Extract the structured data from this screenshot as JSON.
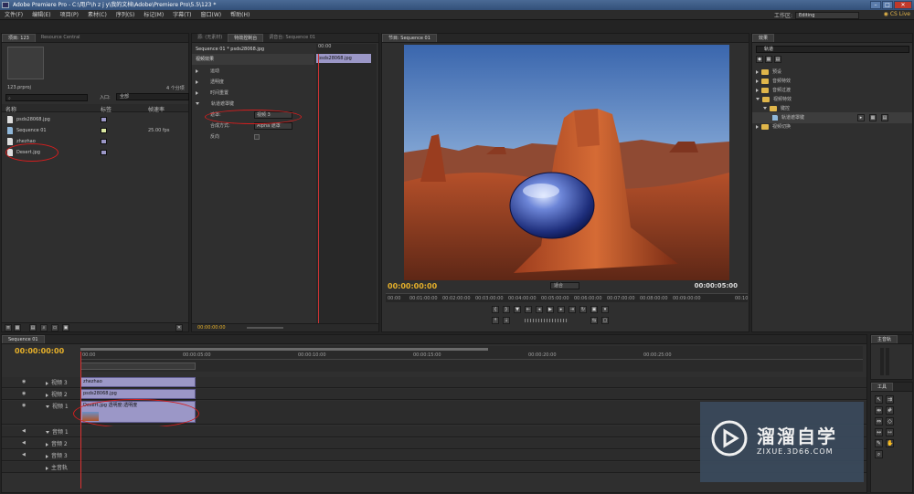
{
  "title_bar": {
    "text": "Adobe Premiere Pro - C:\\用户\\h z j y\\我的文档\\Adobe\\Premiere Pro\\5.5\\123 *"
  },
  "menu": [
    "文件(F)",
    "编辑(E)",
    "项目(P)",
    "素材(C)",
    "序列(S)",
    "标记(M)",
    "字幕(T)",
    "窗口(W)",
    "帮助(H)"
  ],
  "workspace": {
    "label": "工作区:",
    "value": "Editing",
    "cs_live": "CS Live"
  },
  "project_panel": {
    "tabs": [
      "项目: 123",
      "Resource Central"
    ],
    "project_file": "123.prproj",
    "item_count": "4 个分项",
    "search_placeholder": "",
    "in_label": "入口:",
    "in_value": "全部",
    "columns": [
      "名称",
      "标签",
      "帧速率"
    ],
    "items": [
      {
        "name": "psds28068.jpg",
        "label_color": "#9b97c7",
        "fps": ""
      },
      {
        "name": "Sequence 01",
        "label_color": "#d9e6a0",
        "fps": "25.00 fps"
      },
      {
        "name": "zhezhao",
        "label_color": "#9b97c7",
        "fps": ""
      },
      {
        "name": "Desert.jpg",
        "label_color": "#9b97c7",
        "fps": ""
      }
    ]
  },
  "effect_controls": {
    "tabs": [
      "源: (无素材)",
      "特效控制台",
      "调音台: Sequence 01"
    ],
    "header": "Sequence 01 * psds28068.jpg",
    "clip_name": "psds28068.jpg",
    "section": "视频效果",
    "rows": [
      "运动",
      "透明度",
      "时间重置",
      "轨道遮罩键"
    ],
    "mask_label": "遮罩:",
    "mask_value": "视频 3",
    "composite_label": "合成方式:",
    "composite_value": "Alpha 遮罩",
    "reverse_label": "反向",
    "mini_tc": "00:00",
    "footer_tc": "00:00:00:00"
  },
  "program_monitor": {
    "tab": "节目: Sequence 01",
    "current_tc": "00:00:00:00",
    "fit": "适合",
    "duration_tc": "00:00:05:00",
    "ruler": [
      "00:00",
      "00:01:00:00",
      "00:02:00:00",
      "00:03:00:00",
      "00:04:00:00",
      "00:05:00:00",
      "00:06:00:00",
      "00:07:00:00",
      "00:08:00:00",
      "00:09:00:00",
      "00:10"
    ]
  },
  "effects_panel": {
    "tabs": [
      "效果"
    ],
    "search_value": "轨道",
    "tree": [
      {
        "label": "预设",
        "depth": 0
      },
      {
        "label": "音频特效",
        "depth": 0
      },
      {
        "label": "音频过渡",
        "depth": 0
      },
      {
        "label": "视频特效",
        "depth": 0,
        "open": true
      },
      {
        "label": "键控",
        "depth": 1,
        "open": true
      },
      {
        "label": "轨道遮罩键",
        "depth": 2,
        "selected": true
      },
      {
        "label": "视频切换",
        "depth": 0
      }
    ]
  },
  "timeline": {
    "tab": "Sequence 01",
    "current_tc": "00:00:00:00",
    "ruler": [
      "00:00",
      "00:00:05:00",
      "00:00:10:00",
      "00:00:15:00",
      "00:00:20:00",
      "00:00:25:00"
    ],
    "video_tracks": [
      {
        "name": "视频 3",
        "clip": "zhezhao"
      },
      {
        "name": "视频 2",
        "clip": "psds28068.jpg"
      },
      {
        "name": "视频 1",
        "clip": "Desert.jpg 透明度:透明度"
      }
    ],
    "audio_tracks": [
      "音频 1",
      "音频 2",
      "音频 3",
      "主音轨"
    ]
  },
  "master_audio": {
    "tab": "主音轨"
  },
  "tools": {
    "tab": "工具"
  },
  "watermark": {
    "brand": "溜溜自学",
    "url": "ZIXUE.3D66.COM"
  }
}
